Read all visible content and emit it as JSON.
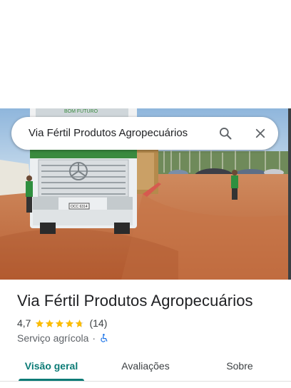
{
  "search": {
    "value": "Via Fértil Produtos Agropecuários",
    "search_icon": "search-icon",
    "close_icon": "close-icon"
  },
  "place": {
    "name": "Via Fértil Produtos Agropecuários",
    "rating": "4,7",
    "rating_value": 4.7,
    "reviews": "(14)",
    "category": "Serviço agrícola",
    "separator": "·",
    "accessibility_icon": "wheelchair-icon"
  },
  "photo": {
    "truck_text": "BOM FUTURO",
    "plate": "OCC 6314"
  },
  "tabs": [
    {
      "label": "Visão geral",
      "active": true
    },
    {
      "label": "Avaliações",
      "active": false
    },
    {
      "label": "Sobre",
      "active": false
    }
  ],
  "colors": {
    "accent": "#0b7b76",
    "star": "#fbbc04",
    "text": "#202124",
    "muted": "#5f6368"
  }
}
